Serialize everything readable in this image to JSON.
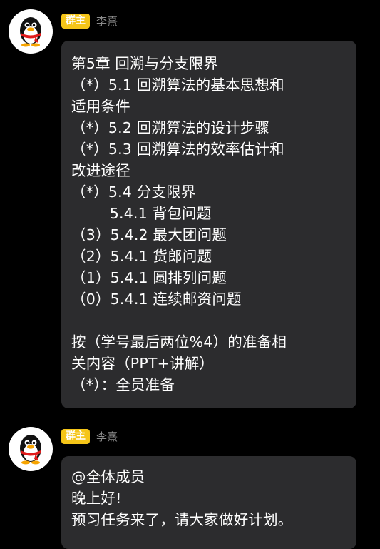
{
  "messages": [
    {
      "badge": "群主",
      "sender": "李熹",
      "lines": [
        "第5章 回溯与分支限界",
        "（*）5.1 回溯算法的基本思想和",
        "适用条件",
        "（*）5.2 回溯算法的设计步骤",
        "（*）5.3 回溯算法的效率估计和",
        "改进途径",
        "（*）5.4 分支限界",
        "        5.4.1 背包问题",
        "（3）5.4.2 最大团问题",
        "（2）5.4.1 货郎问题",
        "（1）5.4.1 圆排列问题",
        "（0）5.4.1 连续邮资问题",
        "",
        "按（学号最后两位%4）的准备相",
        "关内容（PPT+讲解）",
        "（*）：全员准备"
      ]
    },
    {
      "badge": "群主",
      "sender": "李熹",
      "lines": [
        "@全体成员",
        "晚上好!",
        "预习任务来了，请大家做好计划。"
      ]
    }
  ],
  "avatar_icon": "qq-penguin-icon",
  "colors": {
    "badge": "#f5c518",
    "bubble": "#2c2c2e",
    "background": "#000000"
  }
}
